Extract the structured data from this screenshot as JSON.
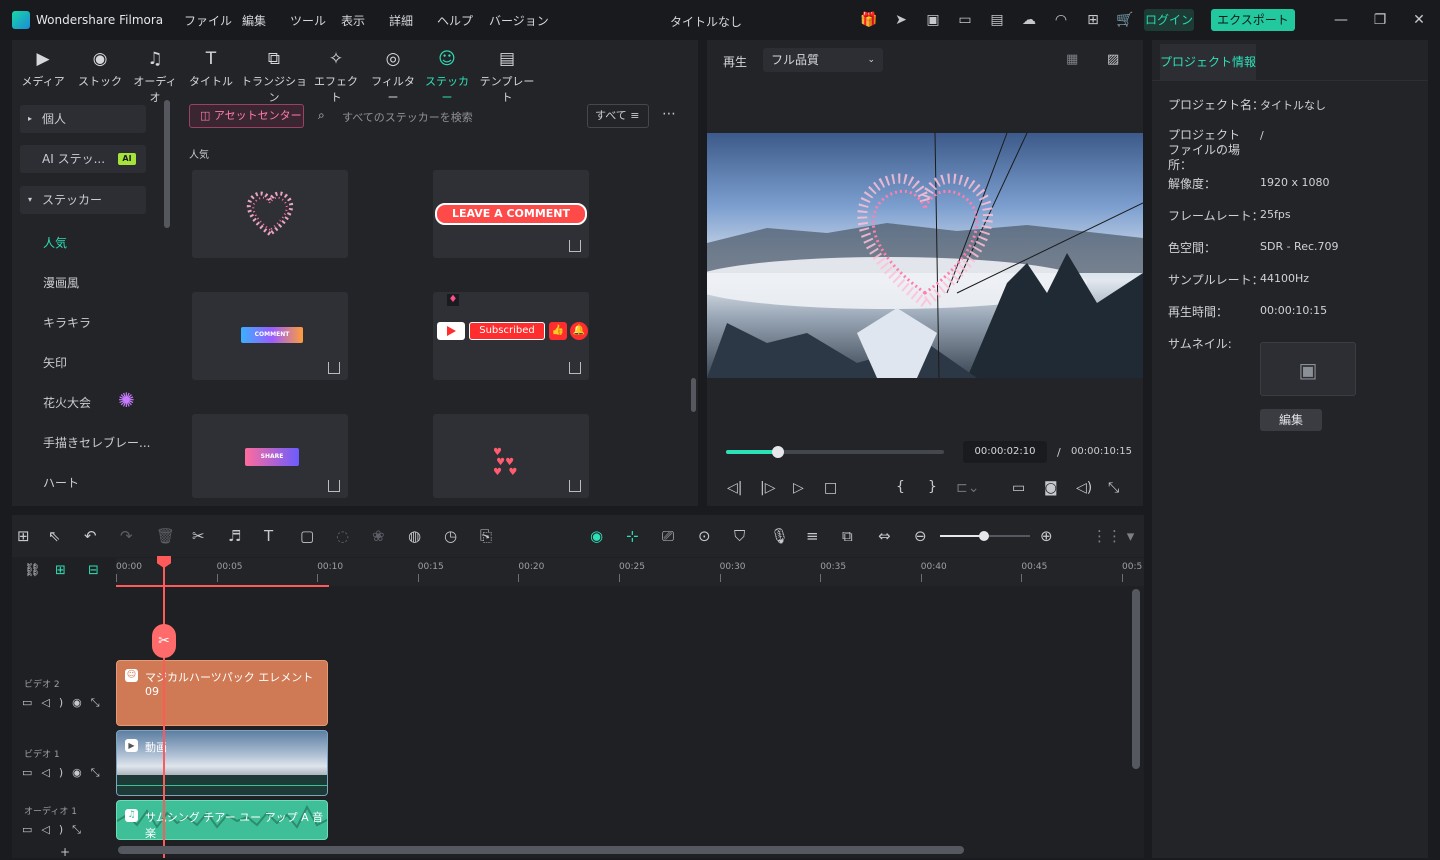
{
  "app": {
    "title": "Wondershare Filmora",
    "window_title": "タイトルなし"
  },
  "menu": [
    "ファイル",
    "編集",
    "ツール",
    "表示",
    "詳細",
    "ヘルプ",
    "バージョン"
  ],
  "header": {
    "login": "ログイン",
    "export": "エクスポート"
  },
  "toolbar": [
    {
      "label": "メディア",
      "icon": "media-icon"
    },
    {
      "label": "ストック",
      "icon": "stock-icon"
    },
    {
      "label": "オーディオ",
      "icon": "audio-icon"
    },
    {
      "label": "タイトル",
      "icon": "title-icon"
    },
    {
      "label": "トランジション",
      "icon": "transition-icon"
    },
    {
      "label": "エフェクト",
      "icon": "effect-icon"
    },
    {
      "label": "フィルター",
      "icon": "filter-icon"
    },
    {
      "label": "ステッカー",
      "icon": "sticker-icon",
      "active": true
    },
    {
      "label": "テンプレート",
      "icon": "template-icon"
    }
  ],
  "sidebar": {
    "personal": "個人",
    "ai_sticker": "AI ステッ...",
    "ai_badge": "AI",
    "sticker": "ステッカー",
    "items": [
      "人気",
      "漫画風",
      "キラキラ",
      "矢印",
      "花火大会",
      "手描きセレブレー...",
      "ハート"
    ]
  },
  "library": {
    "asset_center": "アセットセンター",
    "search_placeholder": "すべてのステッカーを検索",
    "filter": "すべて",
    "section": "人気",
    "cards": [
      {
        "name": "heart-sparkle"
      },
      {
        "name": "leave-a-comment",
        "text": "LEAVE A COMMENT"
      },
      {
        "name": "comment",
        "text": "COMMENT"
      },
      {
        "name": "subscribed",
        "text": "Subscribed"
      },
      {
        "name": "share",
        "text": "SHARE"
      },
      {
        "name": "hearts"
      }
    ]
  },
  "preview": {
    "play_label": "再生",
    "quality": "フル品質",
    "current_time": "00:00:02:10",
    "separator": "/",
    "total_time": "00:00:10:15",
    "progress": 0.24
  },
  "props": {
    "tab": "プロジェクト情報",
    "rows": [
      {
        "label": "プロジェクト名：",
        "value": "タイトルなし"
      },
      {
        "label": "プロジェクトファイルの場所：",
        "value": "/"
      },
      {
        "label": "解像度：",
        "value": "1920 x 1080"
      },
      {
        "label": "フレームレート：",
        "value": "25fps"
      },
      {
        "label": "色空間：",
        "value": "SDR - Rec.709"
      },
      {
        "label": "サンプルレート：",
        "value": "44100Hz"
      },
      {
        "label": "再生時間：",
        "value": "00:00:10:15"
      },
      {
        "label": "サムネイル:",
        "value": ""
      }
    ],
    "edit_button": "編集"
  },
  "timeline": {
    "ticks": [
      "00:00",
      "00:05",
      "00:10",
      "00:15",
      "00:20",
      "00:25",
      "00:30",
      "00:35",
      "00:40",
      "00:45",
      "00:5"
    ],
    "tracks": [
      {
        "name": "ビデオ 2",
        "clip": "マジカルハーツパック エレメント09"
      },
      {
        "name": "ビデオ 1",
        "clip": "動画"
      },
      {
        "name": "オーディオ 1",
        "clip": "サムシング チアー ユー アップ A 音楽"
      }
    ]
  },
  "colors": {
    "accent": "#22c99f",
    "clip_sticker": "#cf7a55",
    "clip_audio": "#3fbf97",
    "playhead": "#ff5a5a"
  }
}
